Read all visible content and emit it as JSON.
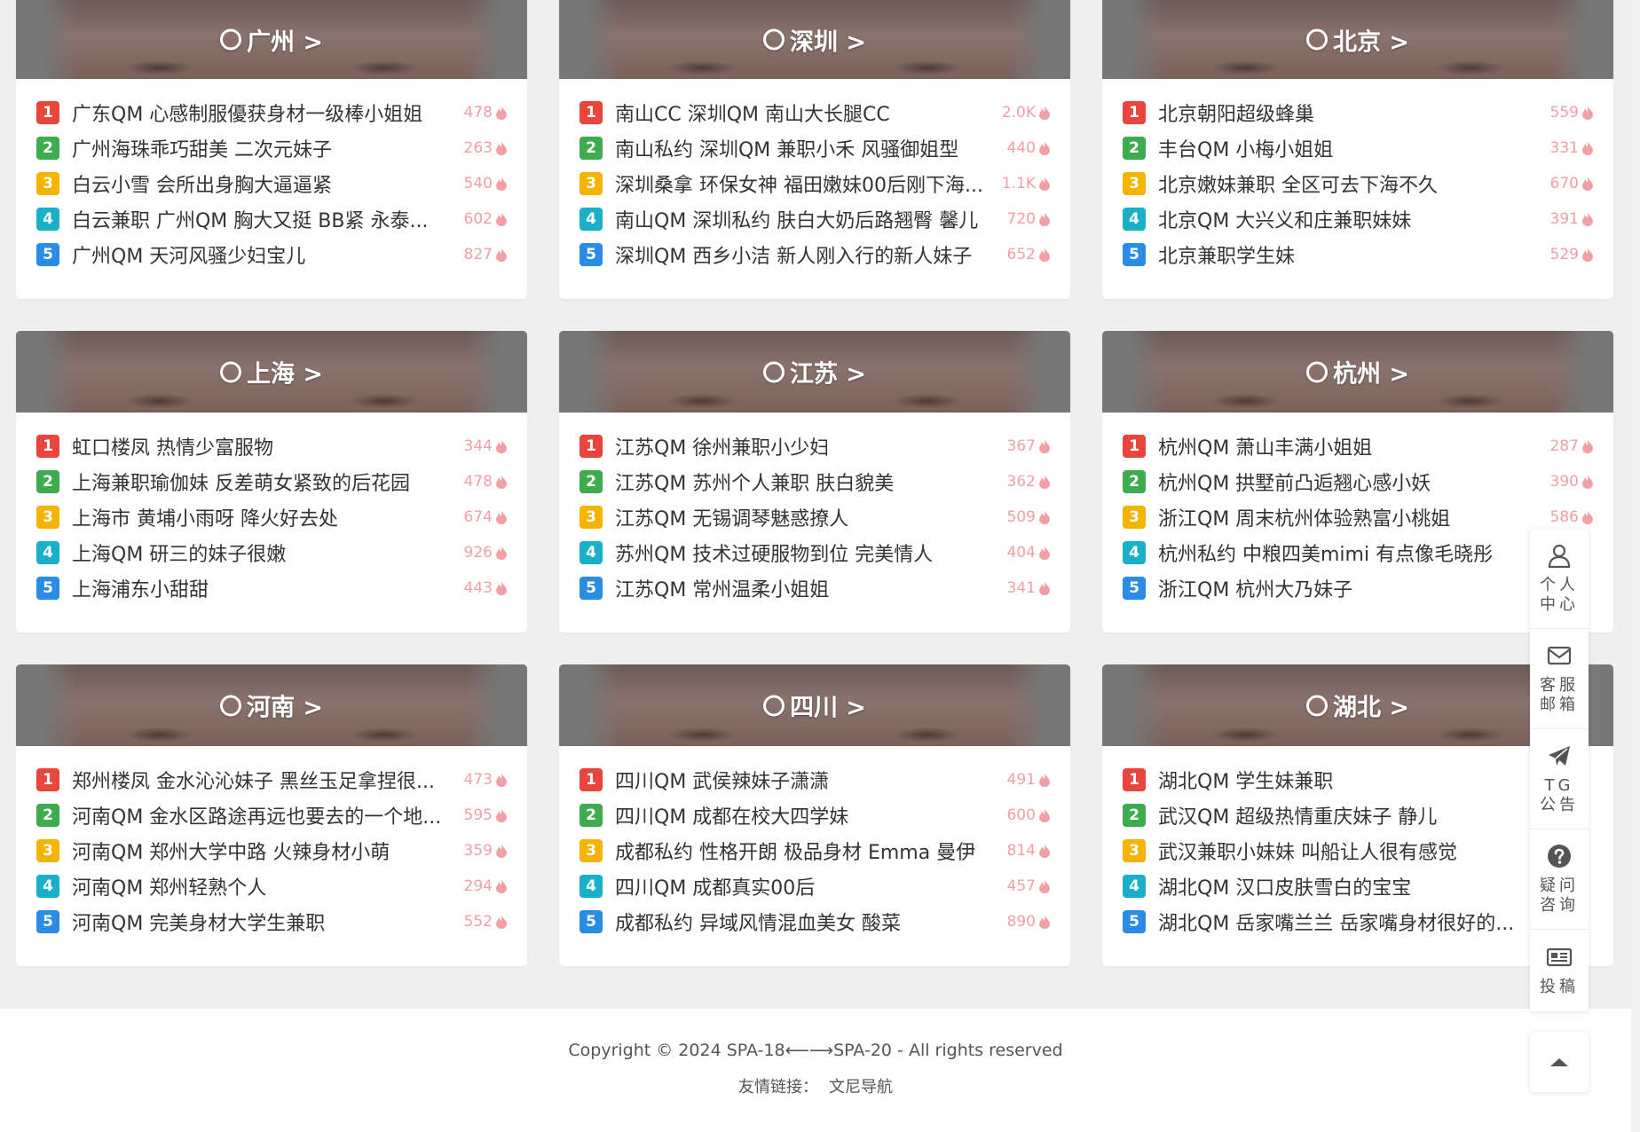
{
  "cards": [
    {
      "region": "广州 >",
      "items": [
        {
          "rank": "1",
          "title": "广东QM 心感制服優获身材一级棒小姐姐",
          "count": "478"
        },
        {
          "rank": "2",
          "title": "广州海珠乖巧甜美 二次元妹子",
          "count": "263"
        },
        {
          "rank": "3",
          "title": "白云小雪 会所出身胸大逼逼紧",
          "count": "540"
        },
        {
          "rank": "4",
          "title": "白云兼职 广州QM 胸大又挺 BB紧 永泰...",
          "count": "602"
        },
        {
          "rank": "5",
          "title": "广州QM 天河风骚少妇宝儿",
          "count": "827"
        }
      ]
    },
    {
      "region": "深圳 >",
      "items": [
        {
          "rank": "1",
          "title": "南山CC 深圳QM 南山大长腿CC",
          "count": "2.0K"
        },
        {
          "rank": "2",
          "title": "南山私约 深圳QM 兼职小禾 风骚御姐型",
          "count": "440"
        },
        {
          "rank": "3",
          "title": "深圳桑拿 环保女神 福田嫩妹00后刚下海...",
          "count": "1.1K"
        },
        {
          "rank": "4",
          "title": "南山QM 深圳私约 肤白大奶后路翘臀 馨儿",
          "count": "720"
        },
        {
          "rank": "5",
          "title": "深圳QM 西乡小洁 新人刚入行的新人妹子",
          "count": "652"
        }
      ]
    },
    {
      "region": "北京 >",
      "items": [
        {
          "rank": "1",
          "title": "北京朝阳超级蜂巢",
          "count": "559"
        },
        {
          "rank": "2",
          "title": "丰台QM 小梅小姐姐",
          "count": "331"
        },
        {
          "rank": "3",
          "title": "北京嫩妹兼职 全区可去下海不久",
          "count": "670"
        },
        {
          "rank": "4",
          "title": "北京QM 大兴义和庄兼职妹妹",
          "count": "391"
        },
        {
          "rank": "5",
          "title": "北京兼职学生妹",
          "count": "529"
        }
      ]
    },
    {
      "region": "上海 >",
      "items": [
        {
          "rank": "1",
          "title": "虹口楼凤 热情少富服物",
          "count": "344"
        },
        {
          "rank": "2",
          "title": "上海兼职瑜伽妹 反差萌女紧致的后花园",
          "count": "478"
        },
        {
          "rank": "3",
          "title": "上海市 黄埔小雨呀 降火好去处",
          "count": "674"
        },
        {
          "rank": "4",
          "title": "上海QM 研三的妹子很嫩",
          "count": "926"
        },
        {
          "rank": "5",
          "title": "上海浦东小甜甜",
          "count": "443"
        }
      ]
    },
    {
      "region": "江苏 >",
      "items": [
        {
          "rank": "1",
          "title": "江苏QM 徐州兼职小少妇",
          "count": "367"
        },
        {
          "rank": "2",
          "title": "江苏QM 苏州个人兼职 肤白貌美",
          "count": "362"
        },
        {
          "rank": "3",
          "title": "江苏QM 无锡调琴魅惑撩人",
          "count": "509"
        },
        {
          "rank": "4",
          "title": "苏州QM 技术过硬服物到位 完美情人",
          "count": "404"
        },
        {
          "rank": "5",
          "title": "江苏QM 常州温柔小姐姐",
          "count": "341"
        }
      ]
    },
    {
      "region": "杭州 >",
      "items": [
        {
          "rank": "1",
          "title": "杭州QM 萧山丰满小姐姐",
          "count": "287"
        },
        {
          "rank": "2",
          "title": "杭州QM 拱墅前凸逅翘心感小妖",
          "count": "390"
        },
        {
          "rank": "3",
          "title": "浙江QM 周末杭州体验熟富小桃姐",
          "count": "586"
        },
        {
          "rank": "4",
          "title": "杭州私约 中粮四美mimi 有点像毛晓彤",
          "count": ""
        },
        {
          "rank": "5",
          "title": "浙江QM 杭州大乃妹子",
          "count": ""
        }
      ]
    },
    {
      "region": "河南 >",
      "items": [
        {
          "rank": "1",
          "title": "郑州楼凤 金水沁沁妹子 黑丝玉足拿捏很...",
          "count": "473"
        },
        {
          "rank": "2",
          "title": "河南QM 金水区路途再远也要去的一个地...",
          "count": "595"
        },
        {
          "rank": "3",
          "title": "河南QM 郑州大学中路 火辣身材小萌",
          "count": "359"
        },
        {
          "rank": "4",
          "title": "河南QM 郑州轻熟个人",
          "count": "294"
        },
        {
          "rank": "5",
          "title": "河南QM 完美身材大学生兼职",
          "count": "552"
        }
      ]
    },
    {
      "region": "四川 >",
      "items": [
        {
          "rank": "1",
          "title": "四川QM 武侯辣妹子潇潇",
          "count": "491"
        },
        {
          "rank": "2",
          "title": "四川QM 成都在校大四学妹",
          "count": "600"
        },
        {
          "rank": "3",
          "title": "成都私约 性格开朗 极品身材 Emma 曼伊",
          "count": "814"
        },
        {
          "rank": "4",
          "title": "四川QM 成都真实00后",
          "count": "457"
        },
        {
          "rank": "5",
          "title": "成都私约 异域风情混血美女 酸菜",
          "count": "890"
        }
      ]
    },
    {
      "region": "湖北 >",
      "items": [
        {
          "rank": "1",
          "title": "湖北QM 学生妹兼职",
          "count": ""
        },
        {
          "rank": "2",
          "title": "武汉QM 超级热情重庆妹子 静儿",
          "count": ""
        },
        {
          "rank": "3",
          "title": "武汉兼职小妹妹 叫船让人很有感觉",
          "count": ""
        },
        {
          "rank": "4",
          "title": "湖北QM 汉口皮肤雪白的宝宝",
          "count": ""
        },
        {
          "rank": "5",
          "title": "湖北QM 岳家嘴兰兰 岳家嘴身材很好的...",
          "count": ""
        }
      ]
    }
  ],
  "footer": {
    "copyright": "Copyright © 2024 SPA-18⟵⟶SPA-20 - All rights reserved",
    "links_label": "友情链接：",
    "link1": "文尼导航"
  },
  "float_bar": {
    "personal": "个人中心",
    "mail": "客服邮箱",
    "tg": "TG公告",
    "faq": "疑问咨询",
    "submit": "投稿"
  },
  "colors": {
    "rank1": "#e8453c",
    "rank2": "#3eab4f",
    "rank3": "#f4b400",
    "rank4": "#19b0c8",
    "rank5": "#2a8ce4",
    "hot_count": "#f0a0a6"
  }
}
